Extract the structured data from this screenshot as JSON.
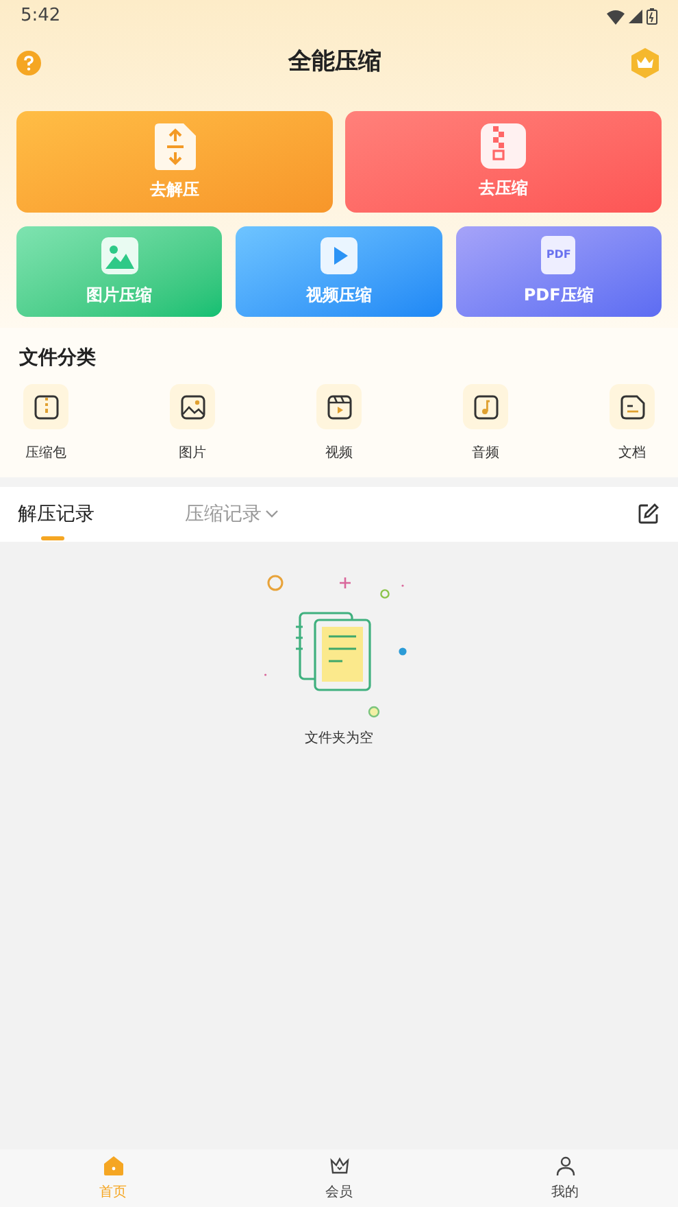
{
  "status_bar": {
    "time": "5:42"
  },
  "header": {
    "title": "全能压缩"
  },
  "main_actions": [
    {
      "label": "去解压"
    },
    {
      "label": "去压缩"
    }
  ],
  "compress_actions": [
    {
      "label": "图片压缩"
    },
    {
      "label": "视频压缩"
    },
    {
      "label": "PDF压缩",
      "icon_text": "PDF"
    }
  ],
  "file_categories": {
    "title": "文件分类",
    "items": [
      {
        "label": "压缩包"
      },
      {
        "label": "图片"
      },
      {
        "label": "视频"
      },
      {
        "label": "音频"
      },
      {
        "label": "文档"
      }
    ]
  },
  "record_tabs": [
    {
      "label": "解压记录",
      "selected": true
    },
    {
      "label": "压缩记录",
      "selected": false
    }
  ],
  "empty_state": {
    "text": "文件夹为空"
  },
  "bottom_nav": [
    {
      "label": "首页",
      "selected": true
    },
    {
      "label": "会员",
      "selected": false
    },
    {
      "label": "我的",
      "selected": false
    }
  ]
}
